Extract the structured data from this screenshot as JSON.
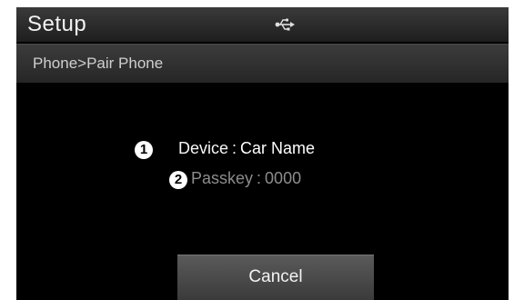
{
  "header": {
    "title": "Setup",
    "status_icon": "usb-icon"
  },
  "breadcrumb": {
    "path": "Phone>Pair Phone"
  },
  "pairing": {
    "device_callout": "1",
    "device_label": "Device",
    "device_separator": ":",
    "device_value": "Car Name",
    "passkey_callout": "2",
    "passkey_label": "Passkey",
    "passkey_separator": ":",
    "passkey_value": "0000"
  },
  "actions": {
    "cancel_label": "Cancel"
  },
  "colors": {
    "background": "#000000",
    "bar": "#2e2e2e",
    "text_primary": "#f2f2f2",
    "text_dimmed": "#8c8c8c"
  }
}
